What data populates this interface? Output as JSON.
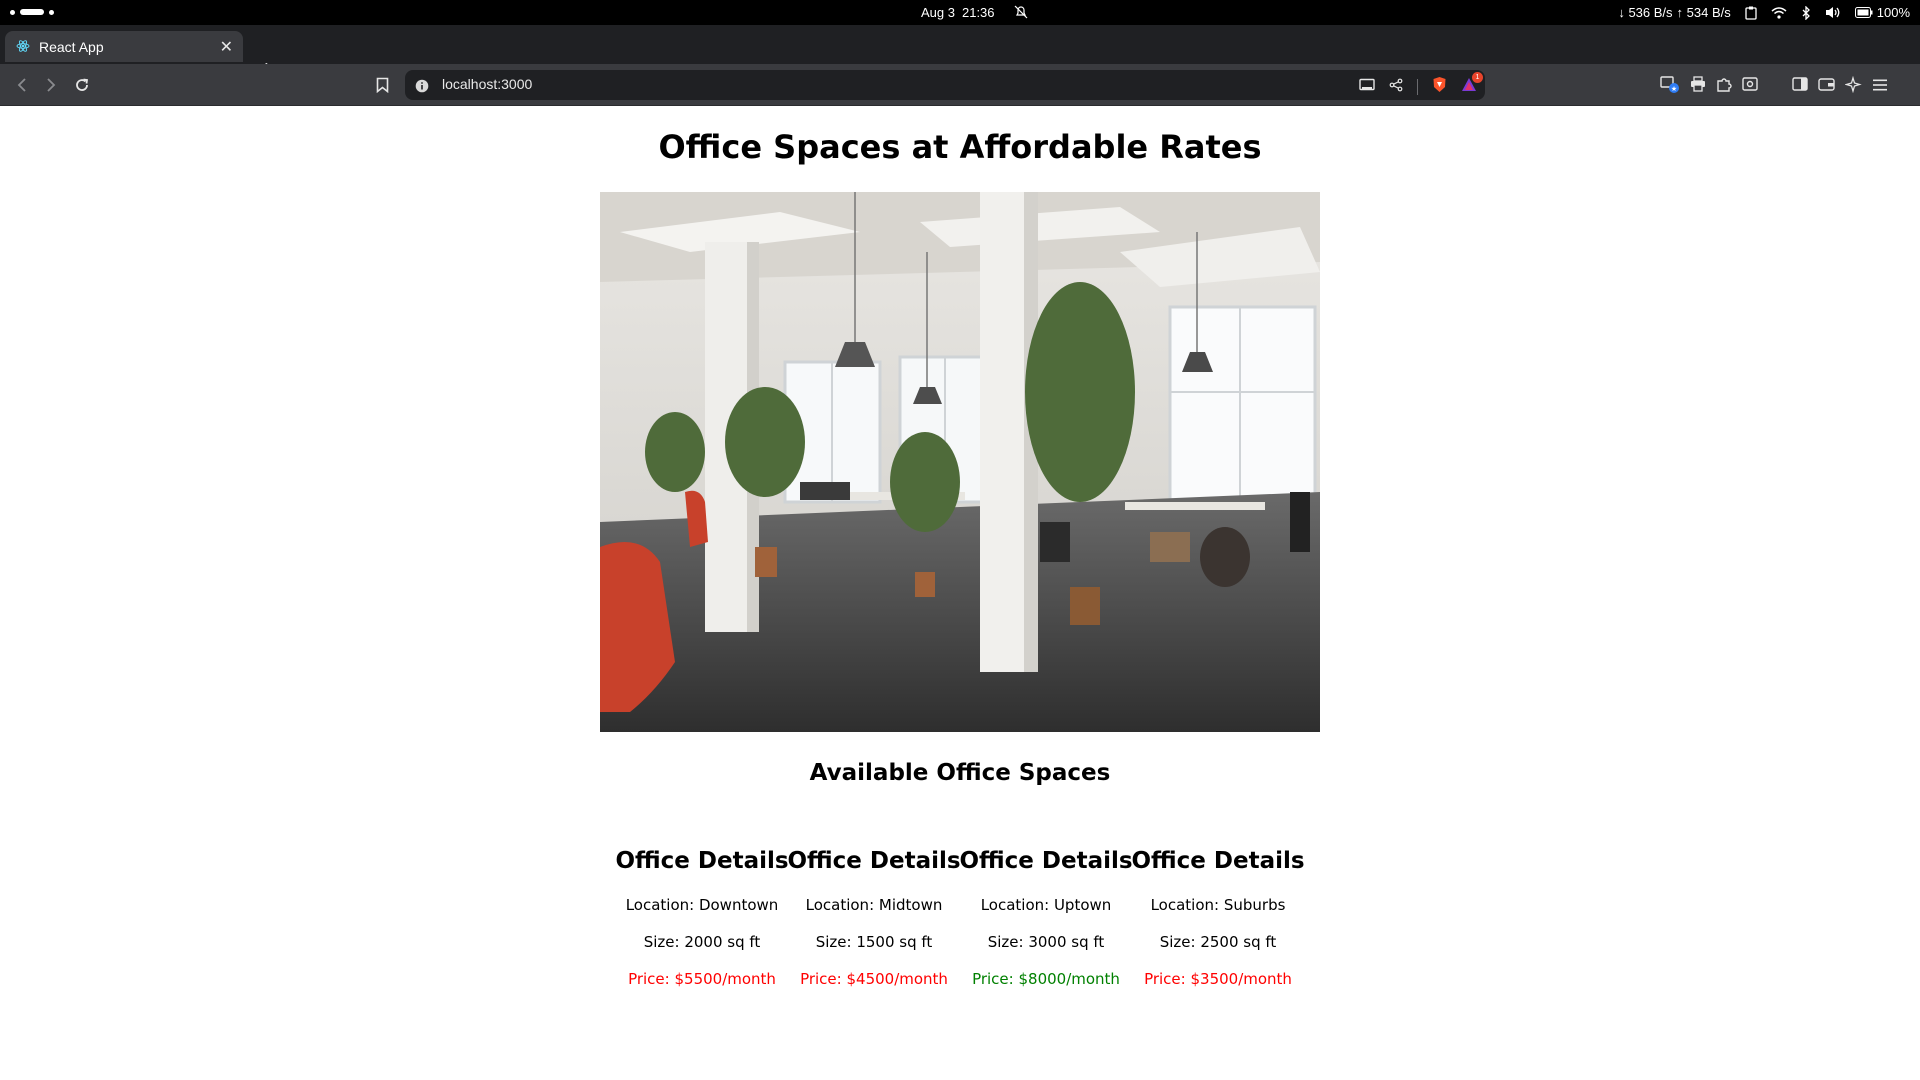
{
  "os": {
    "date": "Aug 3",
    "time": "21:36",
    "net_down": "↓ 536 B/s",
    "net_up": "↑ 534 B/s",
    "battery": "100%"
  },
  "browser": {
    "tab_title": "React App",
    "url": "localhost:3000",
    "shields_badge": "1"
  },
  "page": {
    "title": "Office Spaces at Affordable Rates",
    "section_title": "Available Office Spaces",
    "offices": [
      {
        "heading": "Office Details",
        "location": "Location: Downtown",
        "size": "Size: 2000 sq ft",
        "price": "Price: $5500/month",
        "price_color": "#ff0000"
      },
      {
        "heading": "Office Details",
        "location": "Location: Midtown",
        "size": "Size: 1500 sq ft",
        "price": "Price: $4500/month",
        "price_color": "#ff0000"
      },
      {
        "heading": "Office Details",
        "location": "Location: Uptown",
        "size": "Size: 3000 sq ft",
        "price": "Price: $8000/month",
        "price_color": "#008000"
      },
      {
        "heading": "Office Details",
        "location": "Location: Suburbs",
        "size": "Size: 2500 sq ft",
        "price": "Price: $3500/month",
        "price_color": "#ff0000"
      }
    ]
  }
}
